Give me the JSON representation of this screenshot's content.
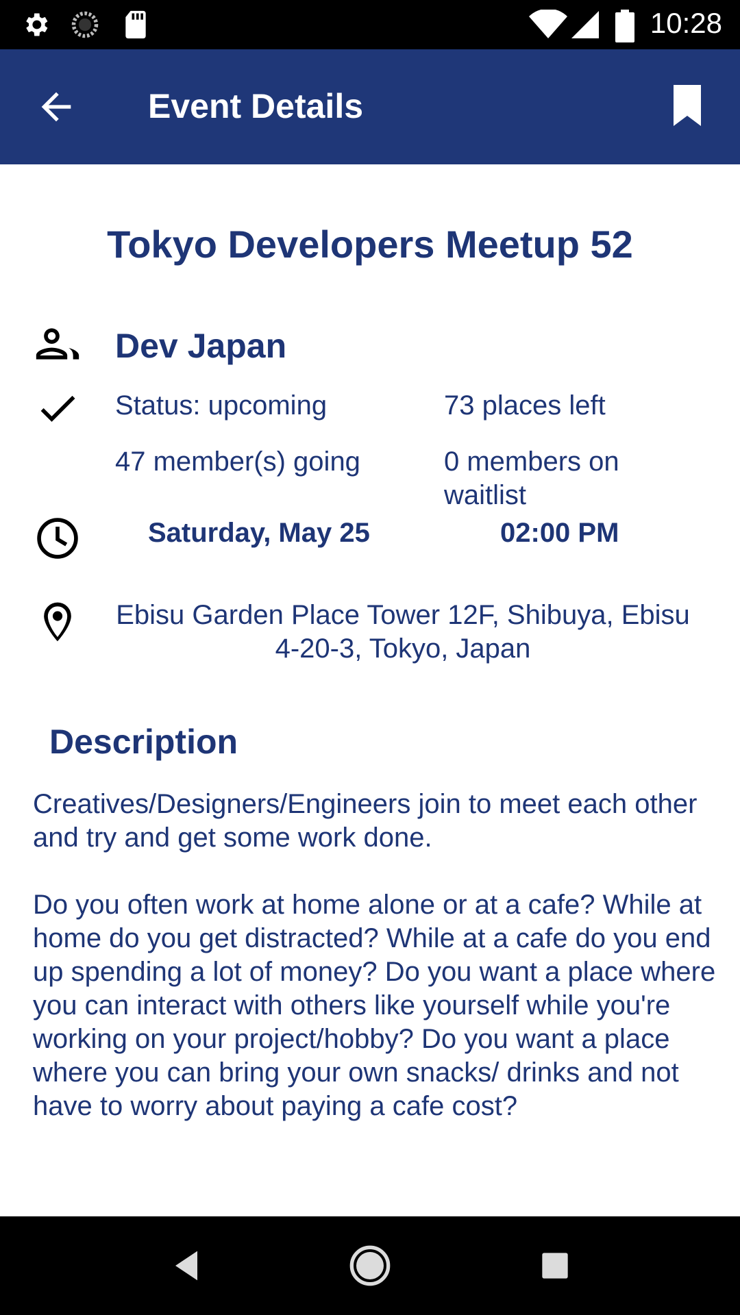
{
  "status_bar": {
    "time": "10:28",
    "icons": [
      "gear-icon",
      "sync-icon",
      "sd-card-icon",
      "wifi-icon",
      "signal-icon",
      "battery-icon"
    ]
  },
  "app_bar": {
    "title": "Event Details",
    "back_icon": "arrow-back-icon",
    "bookmark_icon": "bookmark-icon",
    "background": "#1f3778"
  },
  "event": {
    "title": "Tokyo Developers Meetup 52",
    "group": "Dev Japan",
    "status": "Status: upcoming",
    "places_left": "73 places left",
    "going": "47 member(s) going",
    "waitlist": "0 members on waitlist",
    "date": "Saturday, May 25",
    "time": "02:00 PM",
    "address": "Ebisu Garden Place Tower 12F, Shibuya, Ebisu 4-20-3, Tokyo, Japan"
  },
  "description": {
    "heading": "Description",
    "text": "Creatives/Designers/Engineers join to meet each other and try and get some work done.\n\nDo you often work at home alone or at a cafe? While at home do you get distracted? While at a cafe do you end up spending a lot of money? Do you want a place where you can interact with others like yourself while you're working on your project/hobby? Do you want a place where you can bring your own snacks/ drinks and not have to worry about paying a cafe cost?"
  },
  "nav_bar": {
    "icons": [
      "nav-back-icon",
      "nav-home-icon",
      "nav-recents-icon"
    ]
  },
  "colors": {
    "primary": "#1f3778",
    "text": "#1e3576"
  }
}
